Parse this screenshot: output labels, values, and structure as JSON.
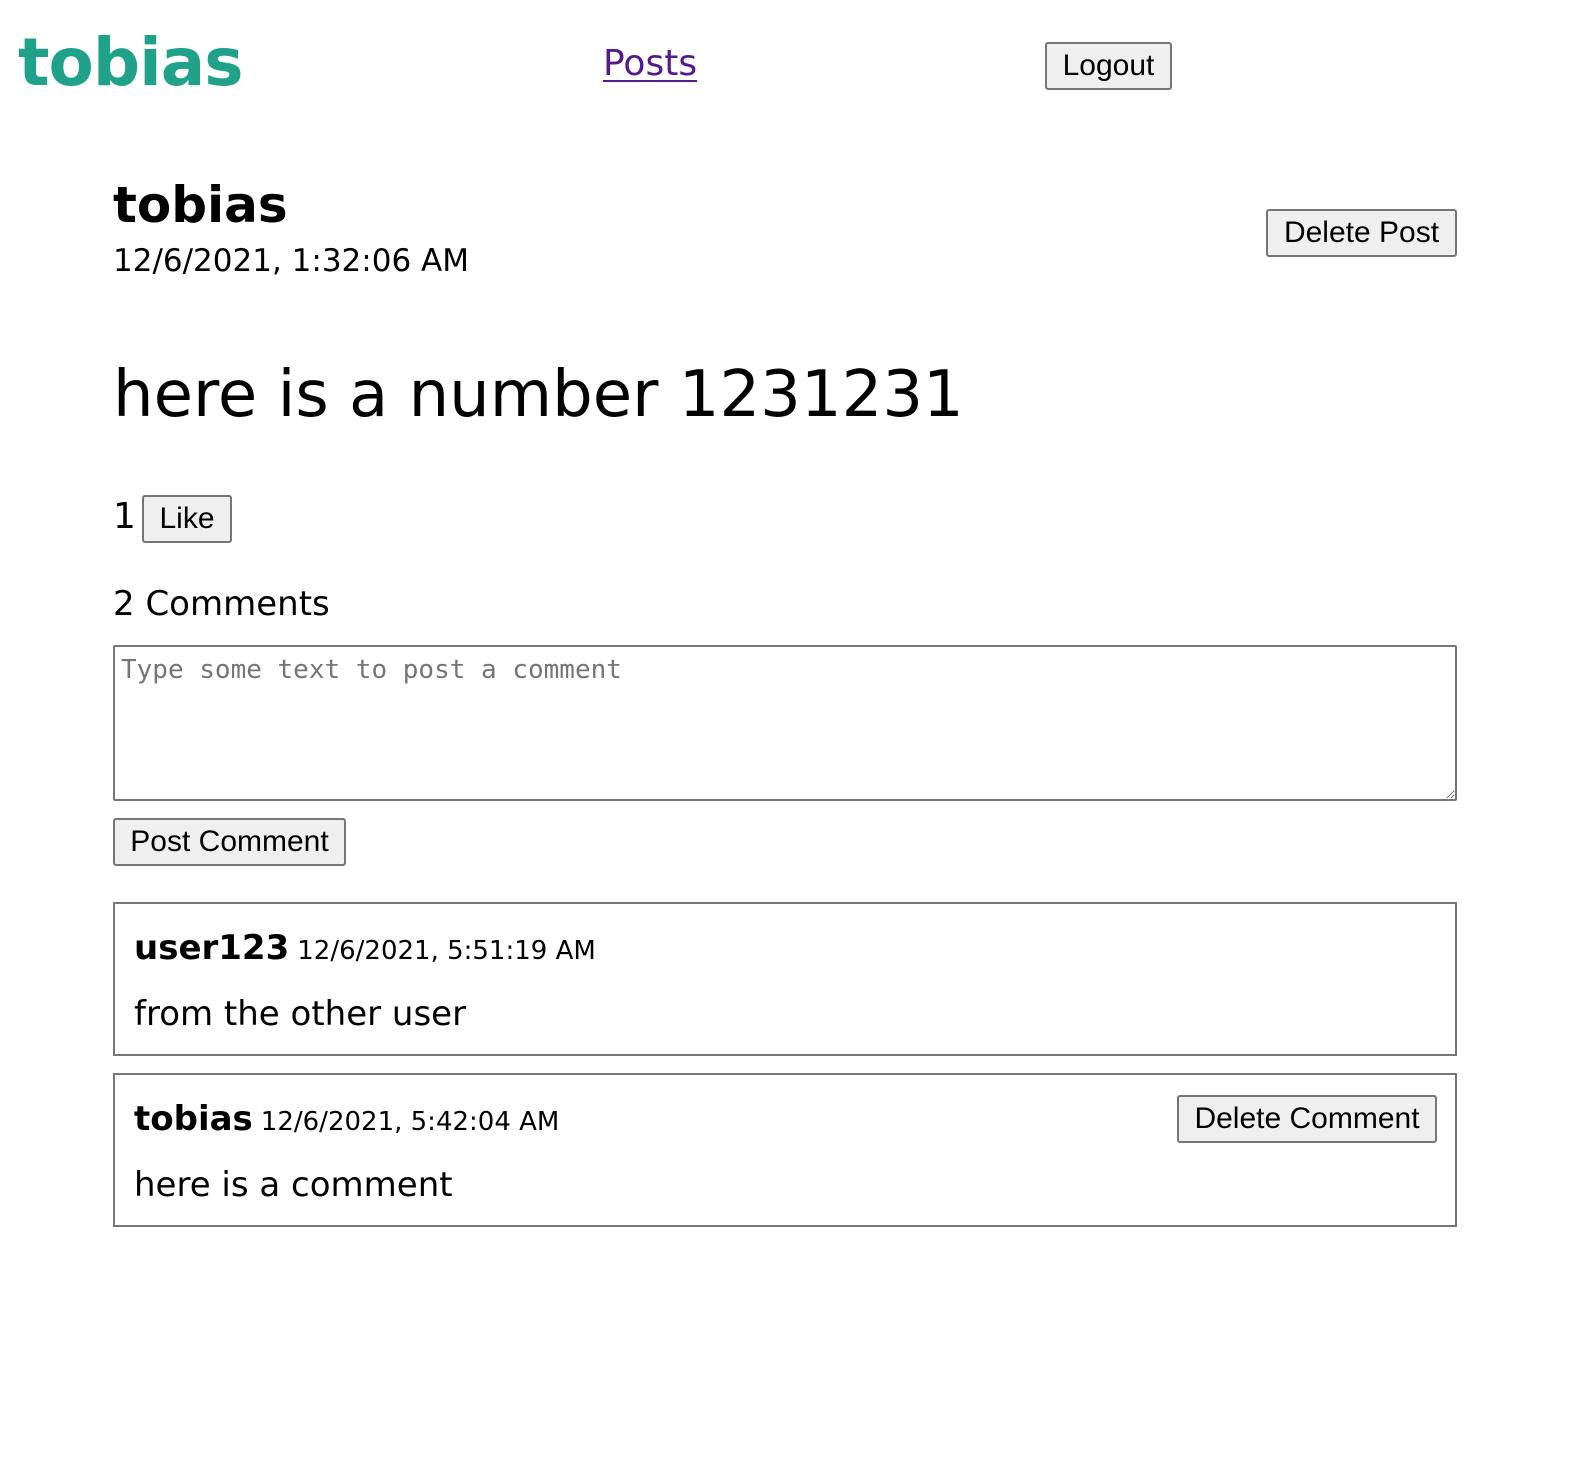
{
  "header": {
    "brand": "tobias",
    "nav_posts": "Posts",
    "logout_label": "Logout"
  },
  "post": {
    "author": "tobias",
    "date": "12/6/2021, 1:32:06 AM",
    "delete_label": "Delete Post",
    "body": "here is a number 1231231",
    "like_count": "1",
    "like_label": "Like"
  },
  "comments_section": {
    "count_label": "2 Comments",
    "input_placeholder": "Type some text to post a comment",
    "input_value": "",
    "post_button_label": "Post Comment",
    "comments": [
      {
        "author": "user123",
        "date": "12/6/2021, 5:51:19 AM",
        "text": "from the other user"
      },
      {
        "author": "tobias",
        "date": "12/6/2021, 5:42:04 AM",
        "text": "here is a comment",
        "delete_label": "Delete Comment"
      }
    ]
  },
  "colors": {
    "brand": "#1fa18a",
    "link": "#551a8b",
    "border": "#767676",
    "button_bg": "#efefef"
  }
}
